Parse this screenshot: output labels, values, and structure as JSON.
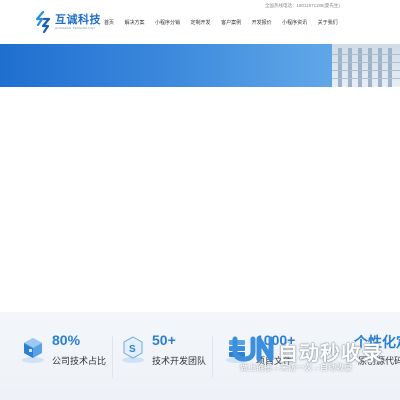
{
  "header": {
    "logo_name": "互诚科技",
    "logo_sub": "HUCHENG TECHNOLOGY",
    "hotline": "全国热线电话：18011971195(夏先生)"
  },
  "nav": {
    "items": [
      "首页",
      "解决方案",
      "小程序分销",
      "定制开发",
      "客户案例",
      "开发报价",
      "小程序资讯",
      "关于我们"
    ]
  },
  "stats": [
    {
      "number": "80%",
      "label": "公司技术占比",
      "icon": "cube-stack-icon"
    },
    {
      "number": "50+",
      "label": "技术开发团队",
      "icon": "s-cube-icon"
    },
    {
      "number": "1000+",
      "label": "项目文件",
      "icon": "server-stack-icon"
    },
    {
      "number": "个性化定",
      "label": "原创源代码",
      "icon": ""
    }
  ],
  "watermark": {
    "title": "自动秒收录",
    "subtitle": "做上链接→来访一次→自动收录"
  },
  "colors": {
    "brand": "#1d6fc6",
    "stat_number": "#2a7fd4",
    "banner_start": "#1f6fd0",
    "banner_end": "#6db0ea"
  }
}
